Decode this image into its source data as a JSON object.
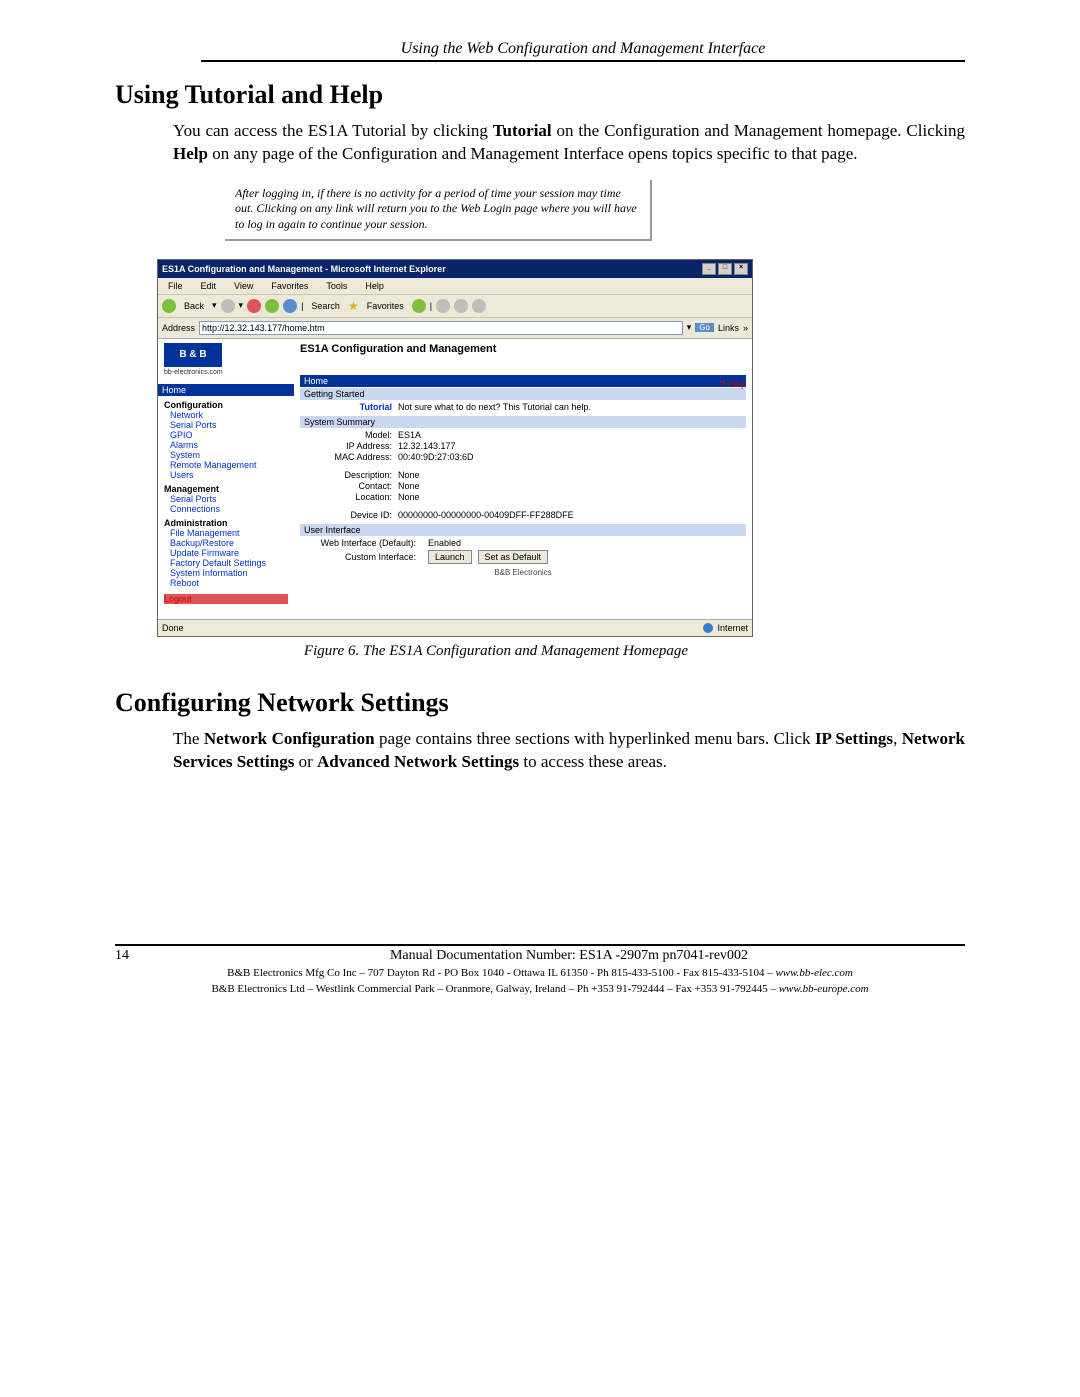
{
  "running_head": "Using the Web Configuration and Management Interface",
  "h_tutorial": "Using Tutorial and Help",
  "para_tutorial_pre": "You can access the ES1A Tutorial by clicking ",
  "para_tutorial_b1": "Tutorial",
  "para_tutorial_mid": " on the Configuration and Management homepage. Clicking ",
  "para_tutorial_b2": "Help",
  "para_tutorial_post": " on any page of the Configuration and Management Interface opens topics specific to that page.",
  "note_text": "After logging in, if there is no activity for a period of time your session may time out. Clicking on any link will return you to the Web Login page where you will have to log in again to continue your session.",
  "shot": {
    "title": "ES1A Configuration and Management - Microsoft Internet Explorer",
    "menus": [
      "File",
      "Edit",
      "View",
      "Favorites",
      "Tools",
      "Help"
    ],
    "toolbar": {
      "back": "Back",
      "search": "Search",
      "favorites": "Favorites"
    },
    "address_label": "Address",
    "address_value": "http://12.32.143.177/home.htm",
    "go": "Go",
    "links": "Links",
    "logo": "B & B",
    "logo_sub": "bb-electronics.com",
    "sidebar_home": "Home",
    "sidebar": {
      "configuration": "Configuration",
      "items_cfg": [
        "Network",
        "Serial Ports",
        "GPIO",
        "Alarms",
        "System",
        "Remote Management",
        "Users"
      ],
      "management": "Management",
      "items_mgmt": [
        "Serial Ports",
        "Connections"
      ],
      "administration": "Administration",
      "items_admin": [
        "File Management",
        "Backup/Restore",
        "Update Firmware",
        "Factory Default Settings",
        "System Information",
        "Reboot"
      ],
      "logout": "Logout"
    },
    "main_title": "ES1A Configuration and Management",
    "help": "Help",
    "bar_home": "Home",
    "sub_getting_started": "Getting Started",
    "tutorial_label": "Tutorial",
    "tutorial_text": "Not sure what to do next? This Tutorial can help.",
    "sub_system_summary": "System Summary",
    "summary": {
      "Model": "ES1A",
      "IP Address": "12.32.143.177",
      "MAC Address": "00:40:9D:27:03:6D",
      "Description": "None",
      "Contact": "None",
      "Location": "None",
      "Device ID": "00000000-00000000-00409DFF-FF288DFE"
    },
    "sub_user_interface": "User Interface",
    "web_interface_label": "Web Interface (Default):",
    "web_interface_value": "Enabled",
    "custom_interface_label": "Custom Interface:",
    "btn_launch": "Launch",
    "btn_setdefault": "Set as Default",
    "bnb_footer": "B&B Electronics",
    "status_done": "Done",
    "status_zone": "Internet"
  },
  "fig_caption": "Figure 6.    The ES1A Configuration and Management Homepage",
  "h_network": "Configuring Network Settings",
  "para_net_pre": "The ",
  "para_net_b1": "Network Configuration",
  "para_net_mid1": " page contains three sections with hyperlinked menu bars. Click ",
  "para_net_b2": "IP Settings",
  "para_net_sep1": ", ",
  "para_net_b3": "Network Services Settings",
  "para_net_sep2": " or ",
  "para_net_b4": "Advanced Network Settings",
  "para_net_post": " to access these areas.",
  "footer": {
    "page": "14",
    "doc": "Manual Documentation Number:  ES1A -2907m     pn7041-rev002",
    "line1a": "B&B Electronics Mfg Co Inc – 707 Dayton Rd - PO Box 1040 - Ottawa IL 61350 - Ph 815-433-5100 - Fax 815-433-5104 – ",
    "line1b": "www.bb-elec.com",
    "line2a": "B&B Electronics Ltd – Westlink Commercial Park – Oranmore, Galway, Ireland – Ph +353 91-792444 – Fax +353 91-792445 – ",
    "line2b": "www.bb-europe.com"
  }
}
